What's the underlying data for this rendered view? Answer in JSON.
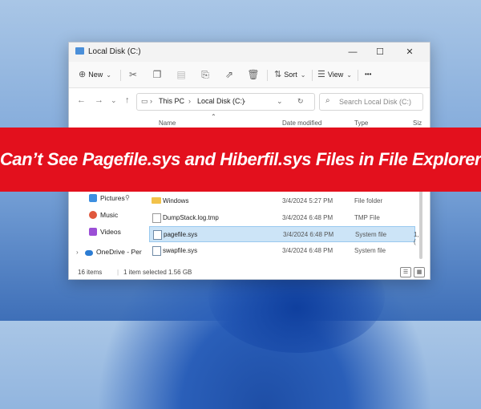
{
  "window": {
    "title": "Local Disk (C:)",
    "controls": {
      "minimize": "—",
      "maximize": "☐",
      "close": "✕"
    }
  },
  "toolbar": {
    "new_label": "New",
    "sort_label": "Sort",
    "view_label": "View",
    "more_label": "•••",
    "icons": [
      "cut-icon",
      "copy-icon",
      "paste-icon",
      "rename-icon",
      "share-icon",
      "delete-icon"
    ]
  },
  "address": {
    "path": [
      "This PC",
      "Local Disk (C:)"
    ],
    "separator": "›",
    "search_placeholder": "Search Local Disk (C:)"
  },
  "columns": {
    "name": "Name",
    "date_modified": "Date modified",
    "type": "Type",
    "size": "Siz"
  },
  "banner": {
    "text": "Can’t See Pagefile.sys and Hiberfil.sys Files in File Explorer",
    "color": "#e3101d"
  },
  "sidebar": {
    "items": [
      {
        "label": "Pictures",
        "icon": "pictures-icon",
        "color": "#3d8fe0"
      },
      {
        "label": "Music",
        "icon": "music-icon",
        "color": "#e0583d"
      },
      {
        "label": "Videos",
        "icon": "videos-icon",
        "color": "#9b4fd6"
      },
      {
        "label": "OneDrive - Per",
        "icon": "onedrive-icon",
        "color": "#2b7cd3"
      }
    ]
  },
  "files": [
    {
      "name": "Windows",
      "date": "3/4/2024 5:27 PM",
      "type": "File folder",
      "size": "",
      "kind": "folder",
      "selected": false
    },
    {
      "name": "DumpStack.log.tmp",
      "date": "3/4/2024 6:48 PM",
      "type": "TMP File",
      "size": "",
      "kind": "file",
      "selected": false
    },
    {
      "name": "pagefile.sys",
      "date": "3/4/2024 6:48 PM",
      "type": "System file",
      "size": "1,(",
      "kind": "file",
      "selected": true
    },
    {
      "name": "swapfile.sys",
      "date": "3/4/2024 6:48 PM",
      "type": "System file",
      "size": "",
      "kind": "file",
      "selected": false
    }
  ],
  "status": {
    "count": "16 items",
    "selection": "1 item selected  1.56 GB"
  },
  "colors": {
    "accent": "#0067c0",
    "selection_bg": "#cce4f7"
  }
}
